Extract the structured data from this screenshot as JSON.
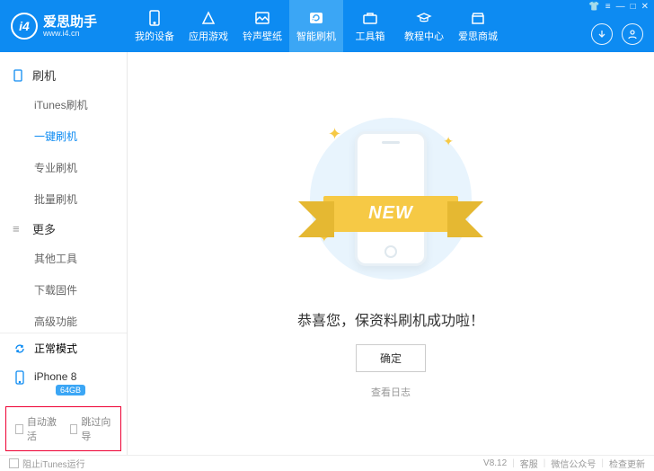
{
  "logo": {
    "badge": "i4",
    "title": "爱思助手",
    "sub": "www.i4.cn"
  },
  "nav": [
    {
      "label": "我的设备"
    },
    {
      "label": "应用游戏"
    },
    {
      "label": "铃声壁纸"
    },
    {
      "label": "智能刷机"
    },
    {
      "label": "工具箱"
    },
    {
      "label": "教程中心"
    },
    {
      "label": "爱思商城"
    }
  ],
  "sidebar": {
    "section1": {
      "title": "刷机",
      "items": [
        "iTunes刷机",
        "一键刷机",
        "专业刷机",
        "批量刷机"
      ]
    },
    "section2": {
      "title": "更多",
      "items": [
        "其他工具",
        "下载固件",
        "高级功能"
      ]
    },
    "mode": "正常模式",
    "device": {
      "name": "iPhone 8",
      "storage": "64GB"
    },
    "check1": "自动激活",
    "check2": "跳过向导"
  },
  "main": {
    "ribbon": "NEW",
    "success": "恭喜您，保资料刷机成功啦！",
    "ok": "确定",
    "log": "查看日志"
  },
  "footer": {
    "block_itunes": "阻止iTunes运行",
    "version": "V8.12",
    "support": "客服",
    "wechat": "微信公众号",
    "update": "检查更新"
  }
}
